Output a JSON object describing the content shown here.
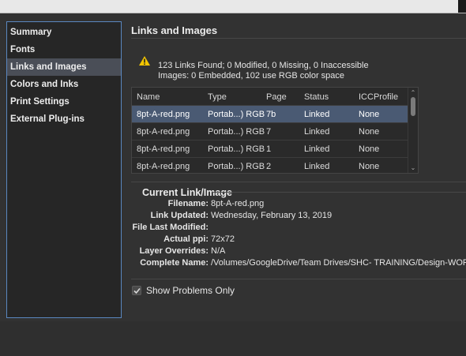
{
  "sidebar": {
    "items": [
      {
        "label": "Summary"
      },
      {
        "label": "Fonts"
      },
      {
        "label": "Links and Images"
      },
      {
        "label": "Colors and Inks"
      },
      {
        "label": "Print Settings"
      },
      {
        "label": "External Plug-ins"
      }
    ],
    "selected": "Links and Images"
  },
  "section": {
    "title": "Links and Images"
  },
  "summary": {
    "line1": "123 Links Found; 0 Modified, 0 Missing, 0 Inaccessible",
    "line2": "Images: 0 Embedded, 102 use RGB color space"
  },
  "table": {
    "columns": [
      "Name",
      "Type",
      "Page",
      "Status",
      "ICCProfile"
    ],
    "rows": [
      {
        "name": "8pt-A-red.png",
        "type": "Portab...) RGB",
        "page": "7b",
        "status": "Linked",
        "icc": "None"
      },
      {
        "name": "8pt-A-red.png",
        "type": "Portab...) RGB",
        "page": "7",
        "status": "Linked",
        "icc": "None"
      },
      {
        "name": "8pt-A-red.png",
        "type": "Portab...) RGB",
        "page": "1",
        "status": "Linked",
        "icc": "None"
      },
      {
        "name": "8pt-A-red.png",
        "type": "Portab...) RGB",
        "page": "2",
        "status": "Linked",
        "icc": "None"
      }
    ]
  },
  "current_link": {
    "title": "Current Link/Image",
    "fields": [
      {
        "label": "Filename:",
        "value": "8pt-A-red.png"
      },
      {
        "label": "Link Updated:",
        "value": "Wednesday, February 13, 2019"
      },
      {
        "label": "File Last Modified:",
        "value": ""
      },
      {
        "label": "Actual ppi:",
        "value": "72x72"
      },
      {
        "label": "Layer Overrides:",
        "value": "N/A"
      },
      {
        "label": "Complete Name:",
        "value": "/Volumes/GoogleDrive/Team Drives/SHC- TRAINING/Design-WOR"
      }
    ]
  },
  "options": {
    "show_problems_only": "Show Problems Only",
    "show_problems_checked": true
  },
  "colors": {
    "warning": "#f2c500",
    "selection": "#4a5a73",
    "sidebar_border": "#5a87c0"
  }
}
